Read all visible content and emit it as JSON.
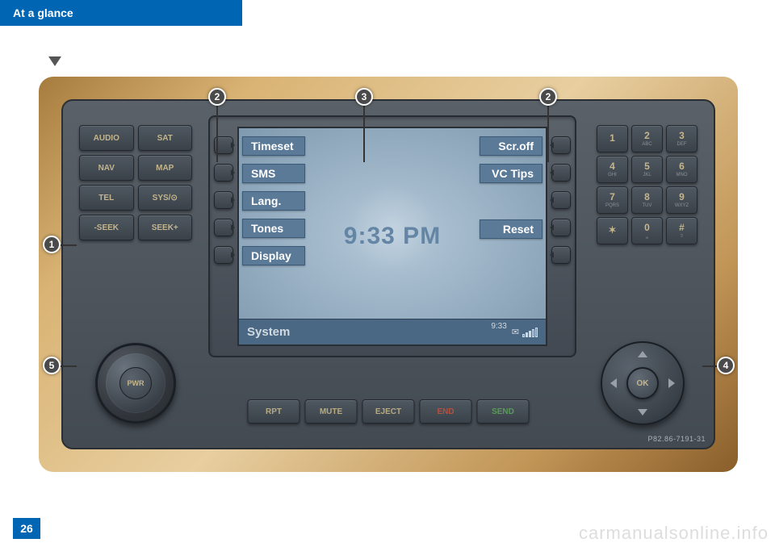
{
  "header": {
    "title": "At a glance"
  },
  "page_number": "26",
  "watermark": "carmanualsonline.info",
  "image_code": "P82.86-7191-31",
  "callouts": [
    "1",
    "2",
    "3",
    "2",
    "4",
    "5"
  ],
  "screen": {
    "left_menu": [
      "Timeset",
      "SMS",
      "Lang.",
      "Tones",
      "Display"
    ],
    "right_menu": [
      "Scr.off",
      "VC Tips",
      "",
      "Reset"
    ],
    "clock": "9:33 PM",
    "status_title": "System",
    "status_time": "9:33"
  },
  "left_buttons": [
    "AUDIO",
    "SAT",
    "NAV",
    "MAP",
    "TEL",
    "SYS/⊙",
    "-SEEK",
    "SEEK+"
  ],
  "keypad": [
    {
      "n": "1",
      "s": ""
    },
    {
      "n": "2",
      "s": "ABC"
    },
    {
      "n": "3",
      "s": "DEF"
    },
    {
      "n": "4",
      "s": "GHI"
    },
    {
      "n": "5",
      "s": "JKL"
    },
    {
      "n": "6",
      "s": "MNO"
    },
    {
      "n": "7",
      "s": "PQRS"
    },
    {
      "n": "8",
      "s": "TUV"
    },
    {
      "n": "9",
      "s": "WXYZ"
    },
    {
      "n": "✶",
      "s": ""
    },
    {
      "n": "0",
      "s": "␣"
    },
    {
      "n": "#",
      "s": "⇧"
    }
  ],
  "bottom_buttons": [
    {
      "label": "RPT",
      "cls": ""
    },
    {
      "label": "MUTE",
      "cls": ""
    },
    {
      "label": "EJECT",
      "cls": ""
    },
    {
      "label": "END",
      "cls": "red"
    },
    {
      "label": "SEND",
      "cls": "green"
    }
  ],
  "pwr_label": "PWR",
  "ok_label": "OK"
}
